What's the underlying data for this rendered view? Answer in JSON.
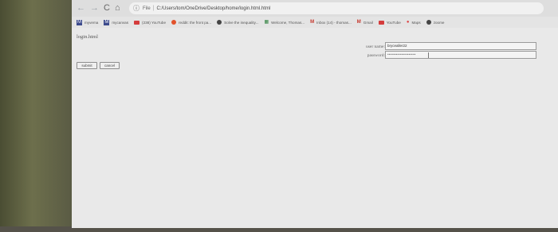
{
  "browser": {
    "back_glyph": "←",
    "forward_glyph": "→",
    "reload_glyph": "C",
    "home_glyph": "⌂",
    "info_glyph": "ⓘ",
    "scheme": "File",
    "address": "C:/Users/tom/OneDrive/Desktop/home/login.html.html"
  },
  "bookmarks": [
    {
      "label": "myvema",
      "icon": "square-icon"
    },
    {
      "label": "mycanvas",
      "icon": "square-icon"
    },
    {
      "label": "(238) YouTube",
      "icon": "youtube-icon"
    },
    {
      "label": "reddit: the front pa...",
      "icon": "reddit-icon"
    },
    {
      "label": "Solve the inequality...",
      "icon": "circle-icon"
    },
    {
      "label": "Welcome, Thomas...",
      "icon": "grid-icon"
    },
    {
      "label": "Inbox (14) - thomas...",
      "icon": "gmail-icon"
    },
    {
      "label": "Gmail",
      "icon": "gmail-icon"
    },
    {
      "label": "YouTube",
      "icon": "youtube-icon"
    },
    {
      "label": "Maps",
      "icon": "maps-icon"
    },
    {
      "label": "zoome",
      "icon": "circle-icon"
    }
  ],
  "page": {
    "title": "login.html",
    "username_label": "user name:",
    "username_value": "brycealler22",
    "password_label": "password:",
    "password_value": "••••••••••••••••••••",
    "submit_label": "submit",
    "cancel_label": "cancel"
  }
}
